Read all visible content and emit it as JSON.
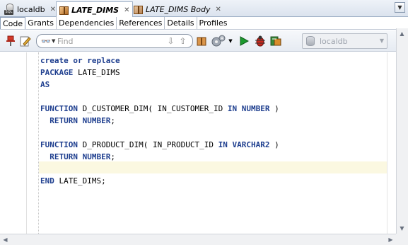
{
  "doc_tabs": [
    {
      "label": "localdb",
      "close": "✕",
      "style": "normal",
      "icon": "database-sql-icon"
    },
    {
      "label": "LATE_DIMS",
      "close": "✕",
      "style": "bold-italic",
      "icon": "package-icon"
    },
    {
      "label": "LATE_DIMS Body",
      "close": "✕",
      "style": "italic",
      "icon": "package-body-icon"
    }
  ],
  "sql_badge": "SQL",
  "sub_tabs": [
    "Code",
    "Grants",
    "Dependencies",
    "References",
    "Details",
    "Profiles"
  ],
  "toolbar": {
    "find_placeholder": "Find",
    "connection": "localdb"
  },
  "code_lines": [
    {
      "text": "create or replace",
      "kind": "kw"
    },
    {
      "text": "PACKAGE",
      "kind": "kw",
      "rest": " LATE_DIMS"
    },
    {
      "text": "AS",
      "kind": "kw"
    },
    {
      "text": "",
      "kind": "blank"
    },
    {
      "parts": [
        [
          "FUNCTION",
          "kw"
        ],
        [
          " D_CUSTOMER_DIM( IN_CUSTOMER_ID ",
          ""
        ],
        [
          "IN",
          "kw"
        ],
        [
          " ",
          ""
        ],
        [
          "NUMBER",
          "kw"
        ],
        [
          " )",
          ""
        ]
      ]
    },
    {
      "parts": [
        [
          "  ",
          ""
        ],
        [
          "RETURN",
          "kw"
        ],
        [
          " ",
          ""
        ],
        [
          "NUMBER",
          "kw"
        ],
        [
          ";",
          ""
        ]
      ]
    },
    {
      "text": "",
      "kind": "blank"
    },
    {
      "parts": [
        [
          "FUNCTION",
          "kw"
        ],
        [
          " D_PRODUCT_DIM( IN_PRODUCT_ID ",
          ""
        ],
        [
          "IN",
          "kw"
        ],
        [
          " ",
          ""
        ],
        [
          "VARCHAR2",
          "kw"
        ],
        [
          " )",
          ""
        ]
      ]
    },
    {
      "parts": [
        [
          "  ",
          ""
        ],
        [
          "RETURN",
          "kw"
        ],
        [
          " ",
          ""
        ],
        [
          "NUMBER",
          "kw"
        ],
        [
          ";",
          ""
        ]
      ]
    },
    {
      "text": "",
      "kind": "blank"
    },
    {
      "parts": [
        [
          "END",
          "kw"
        ],
        [
          " LATE_DIMS;",
          ""
        ]
      ]
    }
  ],
  "colors": {
    "keyword": "#1f3f8f",
    "current_line": "#fbf8e1",
    "run_green": "#1c9a2e",
    "tab_strip": "#dbe3ee"
  }
}
